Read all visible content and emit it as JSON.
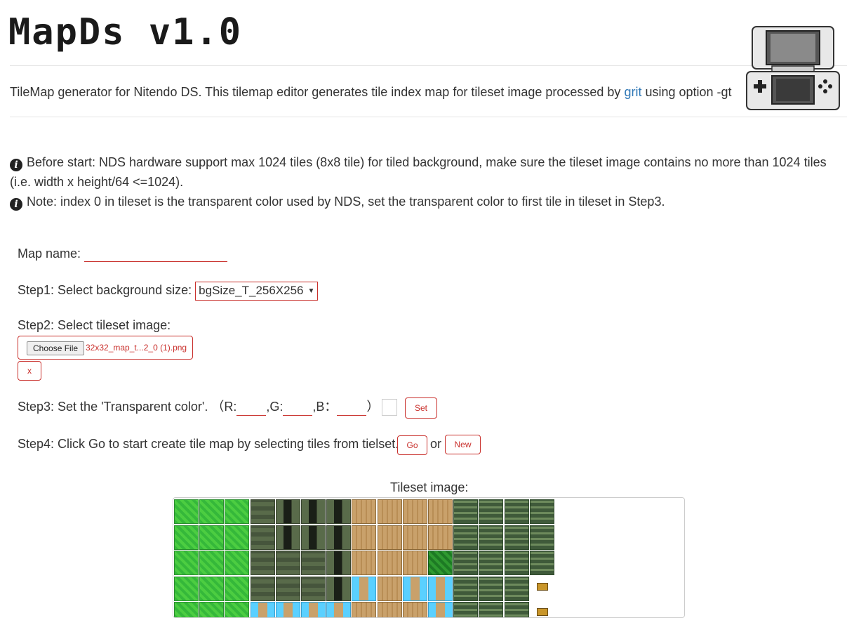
{
  "header": {
    "title": "MapDs v1.0",
    "desc_before": "TileMap generator for Nitendo DS. This tilemap editor generates tile index map for tileset image processed by ",
    "link_text": "grit",
    "desc_after": " using option -gt",
    "device_image": "nintendo-ds-illustration"
  },
  "notes": {
    "before_start": "Before start: NDS hardware support max 1024 tiles (8x8 tile) for tiled background, make sure the tileset image contains no more than 1024 tiles (i.e. width x height/64 <=1024).",
    "note": "Note: index 0 in tileset is the transparent color used by NDS, set the transparent color to first tile in tileset in Step3."
  },
  "form": {
    "map_name_label": "Map name:",
    "map_name_value": "",
    "step1_label": "Step1: Select background size:",
    "step1_selected": "bgSize_T_256X256",
    "step2_label": "Step2: Select tileset image:",
    "choose_file_label": "Choose File",
    "file_name": "32x32_map_t...2_0 (1).png",
    "clear_label": "x",
    "step3_label": "Step3: Set the 'Transparent color'.",
    "r_label": "（R:",
    "g_label": ",G:",
    "b_label": ",B：",
    "close_paren": "）",
    "r_value": "",
    "g_value": "",
    "b_value": "",
    "set_label": "Set",
    "step4_label": "Step4: Click Go to start create tile map by selecting tiles from tielset.",
    "go_label": "Go",
    "or_label": "or",
    "new_label": "New"
  },
  "tileset": {
    "label": "Tileset image:",
    "rows": [
      [
        "grass",
        "grass",
        "grass",
        "stone",
        "stonedoor",
        "stonedoor",
        "stonedoor",
        "wood",
        "wood",
        "wood",
        "wood",
        "fence",
        "fence",
        "fence",
        "fence"
      ],
      [
        "grass",
        "grass",
        "grass",
        "stone",
        "stonedoor",
        "stonedoor",
        "stonedoor",
        "wood",
        "wood",
        "wood",
        "wood",
        "fence",
        "fence",
        "fence",
        "fence"
      ],
      [
        "grass",
        "grass",
        "grass",
        "stone",
        "stone",
        "stone",
        "stonedoor",
        "wood",
        "wood",
        "wood",
        "dkgrass",
        "fence",
        "fence",
        "fence",
        "fence"
      ],
      [
        "grass",
        "grass",
        "grass",
        "stone",
        "stone",
        "stone",
        "stonedoor",
        "water",
        "wood",
        "water",
        "water",
        "fence",
        "fence",
        "fence",
        "chest"
      ],
      [
        "grass",
        "grass",
        "grass",
        "water",
        "water",
        "water",
        "water",
        "wood",
        "wood",
        "wood",
        "water",
        "fence",
        "fence",
        "fence",
        "chest"
      ]
    ]
  },
  "colors": {
    "accent": "#c9302c",
    "link": "#337ab7"
  }
}
